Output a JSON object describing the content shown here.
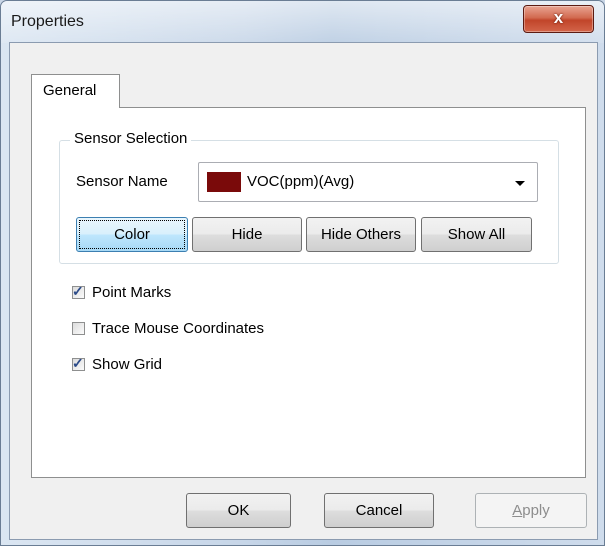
{
  "window": {
    "title": "Properties",
    "close_glyph": "x"
  },
  "tabs": [
    {
      "label": "General",
      "active": true
    }
  ],
  "sensor_selection": {
    "group_title": "Sensor Selection",
    "sensor_label": "Sensor Name",
    "selected_sensor": "VOC(ppm)(Avg)",
    "selected_color": "#7a0a0a",
    "buttons": {
      "color": "Color",
      "hide": "Hide",
      "hide_others": "Hide Others",
      "show_all": "Show All"
    }
  },
  "options": [
    {
      "label": "Point Marks",
      "checked": true
    },
    {
      "label": "Trace Mouse Coordinates",
      "checked": false
    },
    {
      "label": "Show Grid",
      "checked": true
    }
  ],
  "footer": {
    "ok": "OK",
    "cancel": "Cancel",
    "apply_prefix": "A",
    "apply_rest": "pply",
    "apply_enabled": false
  }
}
